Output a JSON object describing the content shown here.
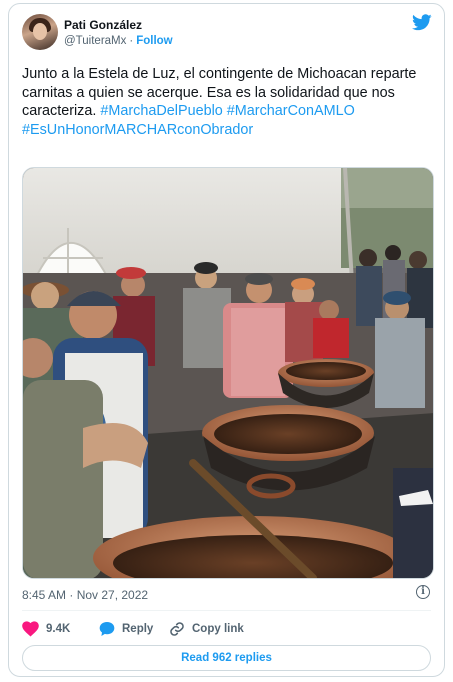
{
  "author": {
    "name": "Pati González",
    "handle": "@TuiteraMx",
    "separator": "·",
    "follow_label": "Follow"
  },
  "tweet": {
    "text": "Junto a la Estela de Luz, el contingente de Michoacan reparte carnitas a quien se acerque. Esa es la solidaridad que nos caracteriza.",
    "hashtags": [
      "#MarchaDelPueblo",
      "#MarcharConAMLO",
      "#EsUnHonorMARCHARconObrador"
    ],
    "timestamp": "8:45 AM · Nov 27, 2022"
  },
  "actions": {
    "likes_count": "9.4K",
    "reply_label": "Reply",
    "copy_link_label": "Copy link",
    "read_replies_label": "Read 962 replies"
  },
  "icons": {
    "brand": "twitter-bird-icon",
    "like": "heart-icon",
    "reply": "speech-bubble-icon",
    "copy": "link-icon",
    "info": "info-icon"
  },
  "colors": {
    "accent": "#1d9bf0",
    "like": "#f91880",
    "muted": "#536471",
    "border": "#cfd9de"
  }
}
